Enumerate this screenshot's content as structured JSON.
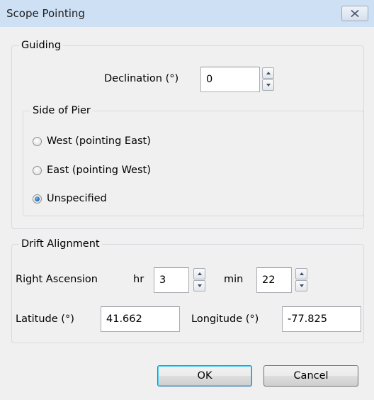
{
  "window": {
    "title": "Scope Pointing",
    "close_icon": "close-icon"
  },
  "guiding": {
    "legend": "Guiding",
    "declination_label": "Declination (°)",
    "declination_value": "0"
  },
  "side_of_pier": {
    "legend": "Side of Pier",
    "options": [
      {
        "label": "West (pointing East)",
        "selected": false
      },
      {
        "label": "East (pointing West)",
        "selected": false
      },
      {
        "label": "Unspecified",
        "selected": true
      }
    ]
  },
  "drift_alignment": {
    "legend": "Drift Alignment",
    "right_ascension_label": "Right Ascension",
    "hr_label": "hr",
    "hr_value": "3",
    "min_label": "min",
    "min_value": "22",
    "latitude_label": "Latitude (°)",
    "latitude_value": "41.662",
    "longitude_label": "Longitude (°)",
    "longitude_value": "-77.825"
  },
  "buttons": {
    "ok_label": "OK",
    "cancel_label": "Cancel"
  }
}
